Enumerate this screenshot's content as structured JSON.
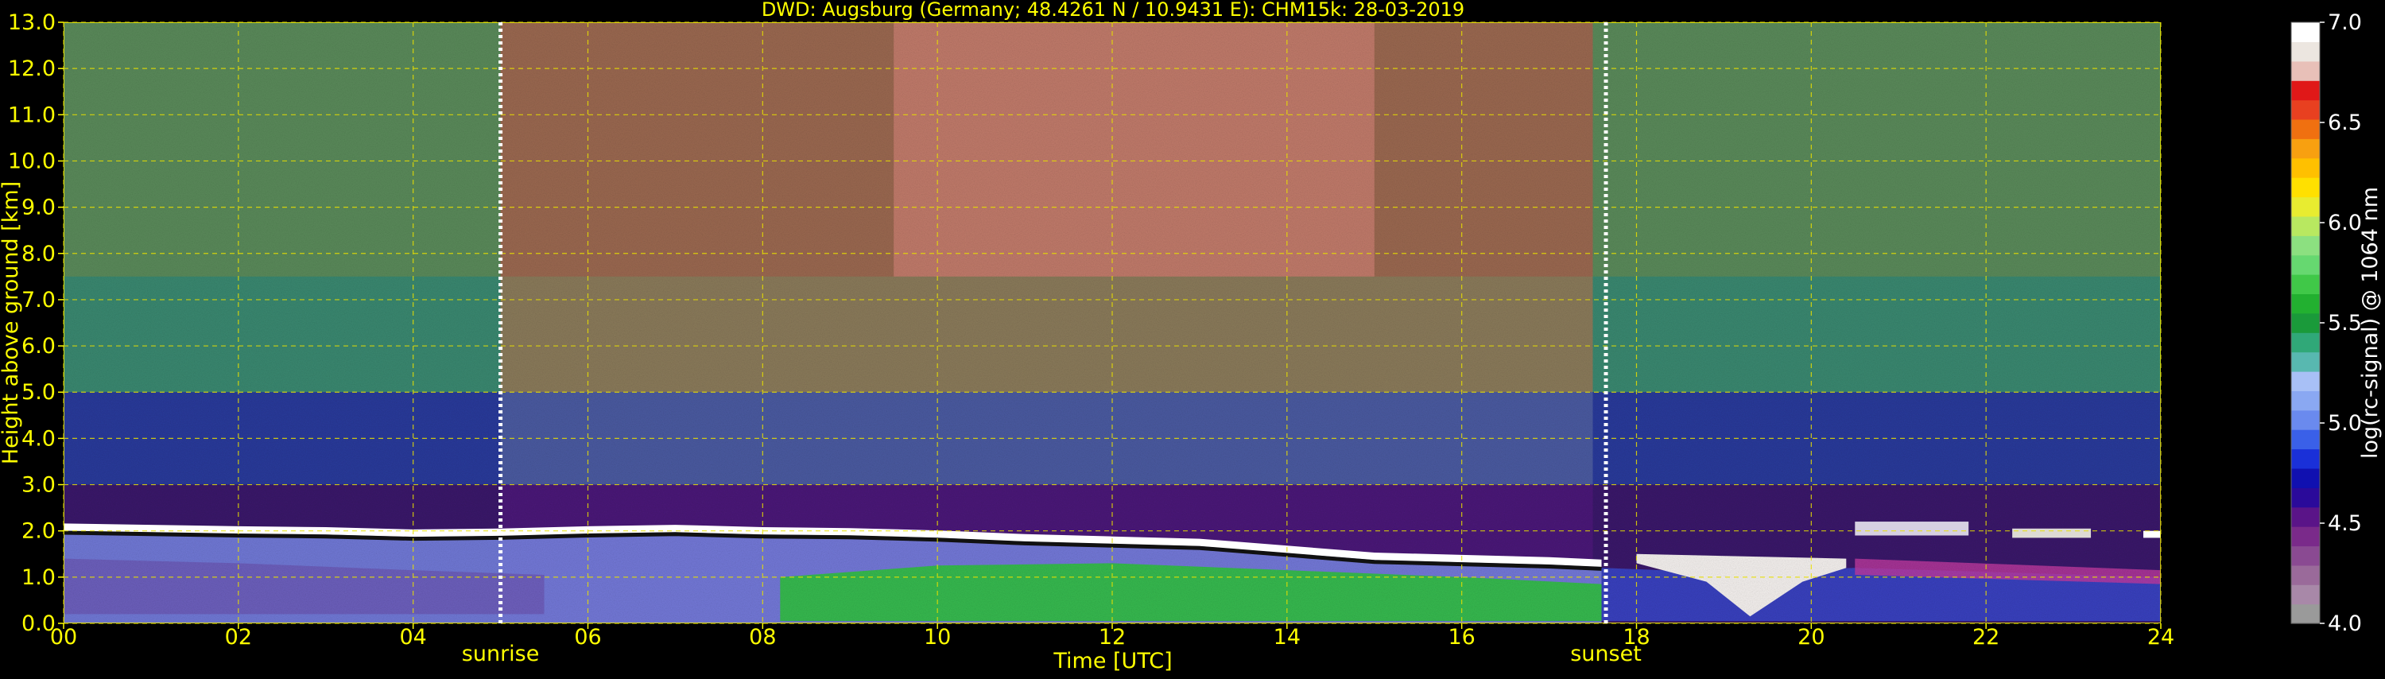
{
  "chart_data": {
    "type": "heatmap",
    "title": "DWD: Augsburg (Germany; 48.4261 N / 10.9431 E):    CHM15k: 28-03-2019",
    "xlabel": "Time [UTC]",
    "ylabel": "Height above ground [km]",
    "xlim": [
      0,
      24
    ],
    "ylim": [
      0,
      13
    ],
    "x_ticks": [
      "00",
      "02",
      "04",
      "06",
      "08",
      "10",
      "12",
      "14",
      "16",
      "18",
      "20",
      "22",
      "24"
    ],
    "y_ticks": [
      "0.0",
      "1.0",
      "2.0",
      "3.0",
      "4.0",
      "5.0",
      "6.0",
      "7.0",
      "8.0",
      "9.0",
      "10.0",
      "11.0",
      "12.0",
      "13.0"
    ],
    "markers": [
      {
        "label": "sunrise",
        "x": 5.0
      },
      {
        "label": "sunset",
        "x": 17.65
      }
    ],
    "boundary_layer_top_km": [
      [
        0,
        2.08
      ],
      [
        1,
        2.05
      ],
      [
        2,
        2.02
      ],
      [
        3,
        2.0
      ],
      [
        4,
        1.95
      ],
      [
        5,
        1.97
      ],
      [
        6,
        2.02
      ],
      [
        7,
        2.05
      ],
      [
        8,
        2.0
      ],
      [
        9,
        1.98
      ],
      [
        10,
        1.93
      ],
      [
        11,
        1.85
      ],
      [
        12,
        1.8
      ],
      [
        13,
        1.75
      ],
      [
        14,
        1.6
      ],
      [
        15,
        1.45
      ],
      [
        16,
        1.4
      ],
      [
        17,
        1.35
      ],
      [
        17.6,
        1.3
      ]
    ],
    "colorbar": {
      "label": "log(rc-signal) @ 1064 nm",
      "range": [
        4.0,
        7.0
      ],
      "ticks": [
        "4.0",
        "4.5",
        "5.0",
        "5.5",
        "6.0",
        "6.5",
        "7.0"
      ],
      "colors": [
        "#9a9a9a",
        "#a888a8",
        "#9a6a9a",
        "#8a4a92",
        "#7a2a8a",
        "#5a1488",
        "#2a0a9a",
        "#1010b0",
        "#1a30d8",
        "#3a60e8",
        "#6a8aee",
        "#8aa8f2",
        "#a8c0f6",
        "#58b8b0",
        "#30a878",
        "#1a9a3a",
        "#22b030",
        "#40c848",
        "#66d870",
        "#8ce080",
        "#b8e860",
        "#e8ec30",
        "#ffe000",
        "#ffc000",
        "#f8a010",
        "#f07010",
        "#e84020",
        "#e01818",
        "#e8c0b8",
        "#ece6e0",
        "#ffffff"
      ]
    }
  }
}
